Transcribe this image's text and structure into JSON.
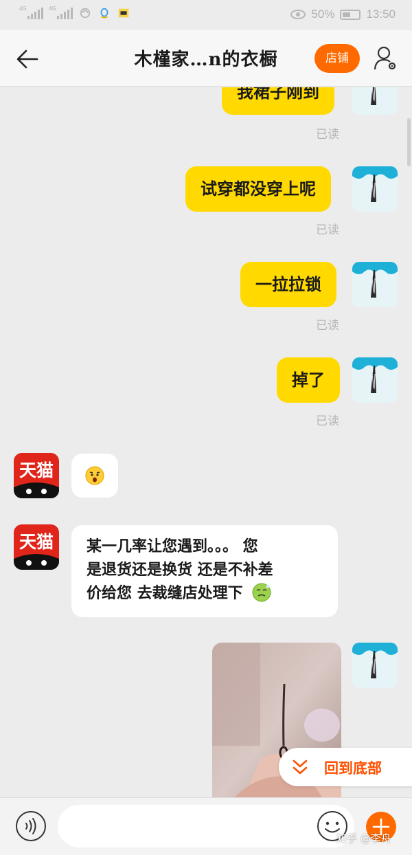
{
  "status_bar": {
    "signal_1_label": "4G",
    "signal_2_label": "4G",
    "battery_percent": "50%",
    "time": "13:50"
  },
  "nav": {
    "title": "木槿家…n的衣橱",
    "shop_button": "店铺"
  },
  "messages": [
    {
      "side": "out",
      "text": "我裙子刚到",
      "read": "已读"
    },
    {
      "side": "out",
      "text": "试穿都没穿上呢",
      "read": "已读"
    },
    {
      "side": "out",
      "text": "一拉拉锁",
      "read": "已读"
    },
    {
      "side": "out",
      "text": "掉了",
      "read": "已读"
    },
    {
      "side": "in",
      "sender_avatar_text": "天猫",
      "text": ""
    },
    {
      "side": "in",
      "sender_avatar_text": "天猫",
      "lines": [
        "某一几率让您遇到。。。 您",
        "是退货还是换货 还是不补差",
        "价给您 去裁缝店处理下"
      ]
    }
  ],
  "back_to_bottom": "回到底部",
  "input_bar": {
    "placeholder": ""
  },
  "watermark": "知乎 @李舟",
  "colors": {
    "accent": "#ff6a00",
    "outgoing_bubble": "#ffd900",
    "tmall_red": "#e0251b"
  }
}
